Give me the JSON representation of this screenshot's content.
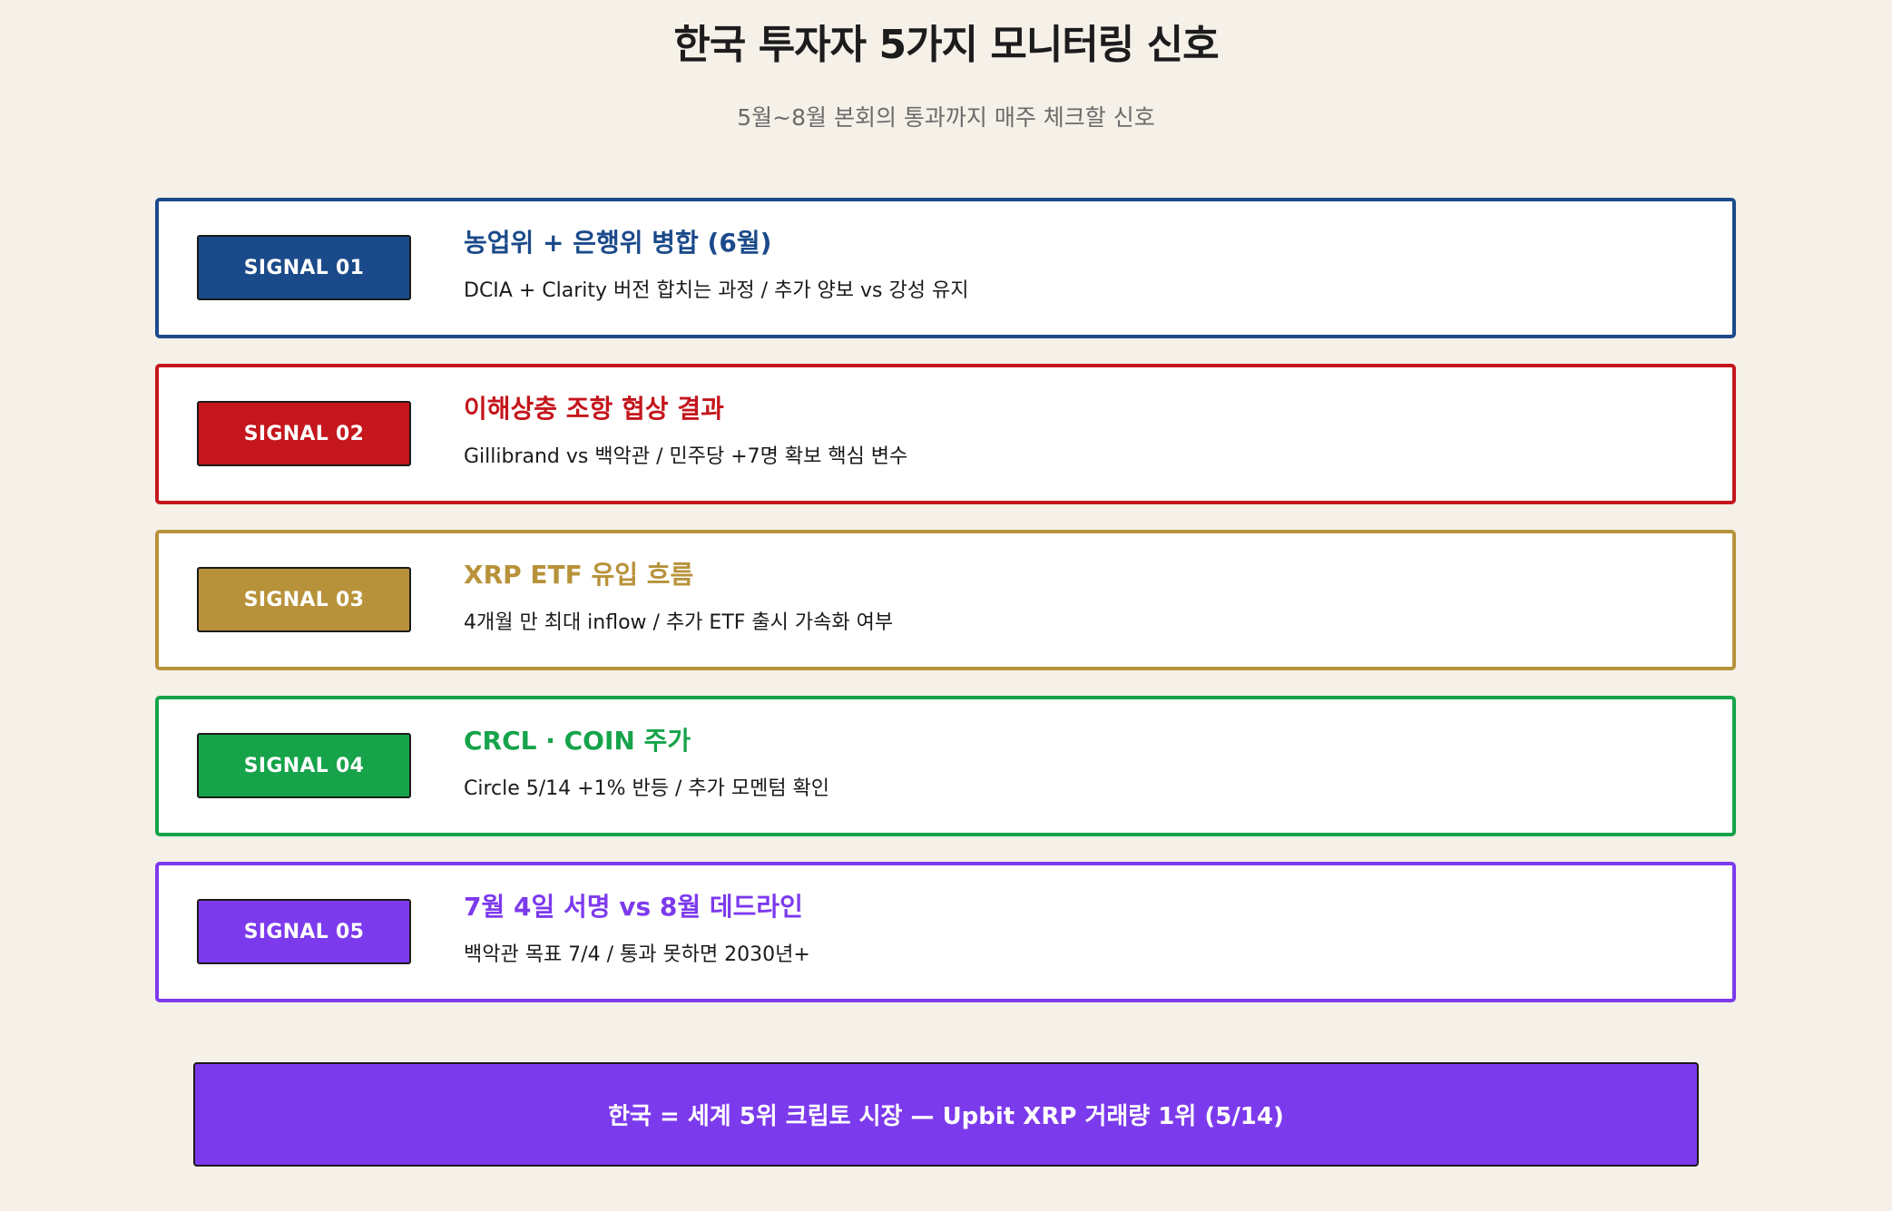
{
  "header": {
    "title": "한국 투자자 5가지 모니터링 신호",
    "subtitle": "5월~8월 본회의 통과까지 매주 체크할 신호"
  },
  "signals": [
    {
      "badge": "SIGNAL 01",
      "title": "농업위 + 은행위 병합 (6월)",
      "description": "DCIA + Clarity 버전 합치는 과정 / 추가 양보 vs 강성 유지",
      "color": "#1b4a8a"
    },
    {
      "badge": "SIGNAL 02",
      "title": "이해상충 조항 협상 결과",
      "description": "Gillibrand vs 백악관 / 민주당 +7명 확보 핵심 변수",
      "color": "#c4161c"
    },
    {
      "badge": "SIGNAL 03",
      "title": "XRP ETF 유입 흐름",
      "description": "4개월 만 최대 inflow / 추가 ETF 출시 가속화 여부",
      "color": "#b8923a"
    },
    {
      "badge": "SIGNAL 04",
      "title": "CRCL · COIN 주가",
      "description": "Circle 5/14 +1% 반등 / 추가 모멘텀 확인",
      "color": "#16a34a"
    },
    {
      "badge": "SIGNAL 05",
      "title": "7월 4일 서명 vs 8월 데드라인",
      "description": "백악관 목표 7/4 / 통과 못하면 2030년+",
      "color": "#7c3aed"
    }
  ],
  "footer": {
    "text": "한국 = 세계 5위 크립토 시장 — Upbit XRP 거래량 1위 (5/14)",
    "color": "#7c3aed"
  }
}
